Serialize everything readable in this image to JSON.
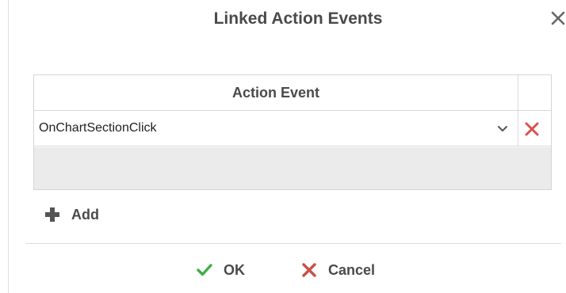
{
  "dialog": {
    "title": "Linked Action Events"
  },
  "grid": {
    "columns": [
      "Action Event"
    ],
    "rows": [
      {
        "action_event": "OnChartSectionClick"
      }
    ]
  },
  "buttons": {
    "add_label": "Add",
    "ok_label": "OK",
    "cancel_label": "Cancel"
  },
  "colors": {
    "delete_red": "#d9534f",
    "ok_green": "#3fae49",
    "cancel_red": "#c9504a",
    "add_gray": "#555555"
  },
  "icons": {
    "close": "close-icon",
    "chevron": "chevron-down-icon",
    "delete": "delete-icon",
    "add": "plus-icon",
    "ok": "check-icon",
    "cancel": "x-icon"
  }
}
